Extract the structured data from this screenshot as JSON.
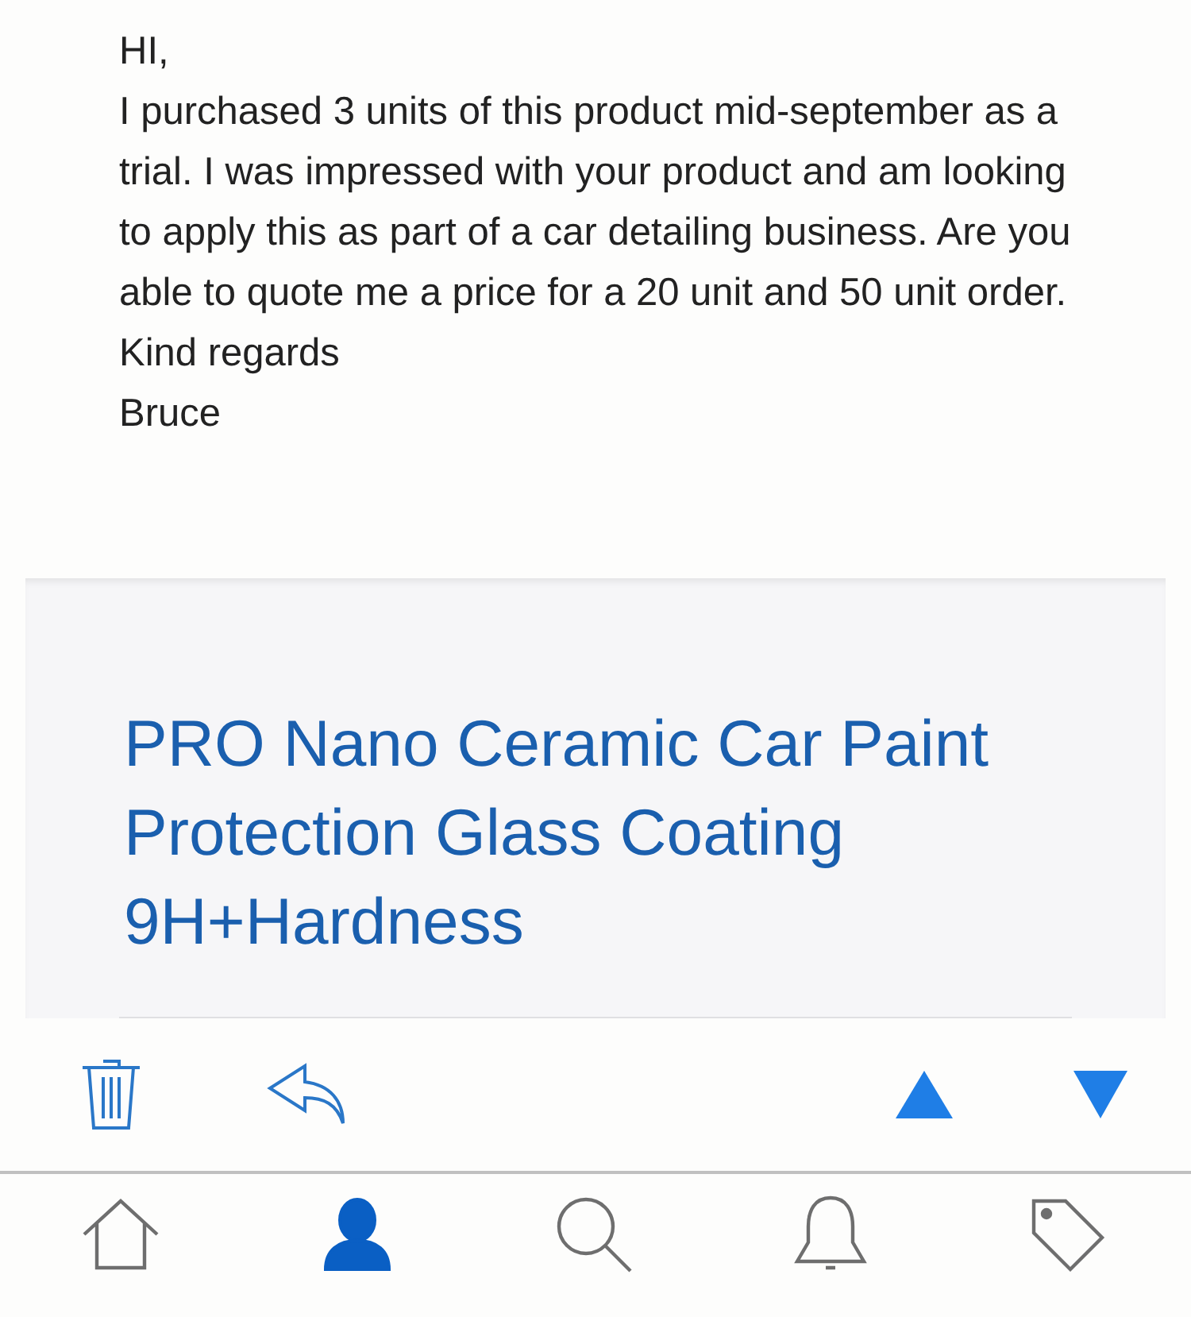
{
  "message": {
    "lines": [
      "HI,",
      "I purchased 3 units of this product mid-september as a trial. I was impressed with your product and am looking to apply this as part of a car detailing business. Are you able to quote me a price for a 20 unit and 50 unit order.",
      "Kind regards",
      "Bruce"
    ]
  },
  "item_card": {
    "title": "PRO Nano Ceramic Car Paint Protection Glass Coating 9H+Hardness"
  },
  "toolbar": [
    {
      "kind": "delete"
    },
    {
      "kind": "reply"
    },
    {
      "kind": "previous"
    },
    {
      "kind": "next"
    }
  ],
  "tab_bar": [
    {
      "kind": "home",
      "selected": false
    },
    {
      "kind": "profile",
      "selected": true
    },
    {
      "kind": "search",
      "selected": false
    },
    {
      "kind": "notifications",
      "selected": false
    },
    {
      "kind": "selling",
      "selected": false
    }
  ]
}
